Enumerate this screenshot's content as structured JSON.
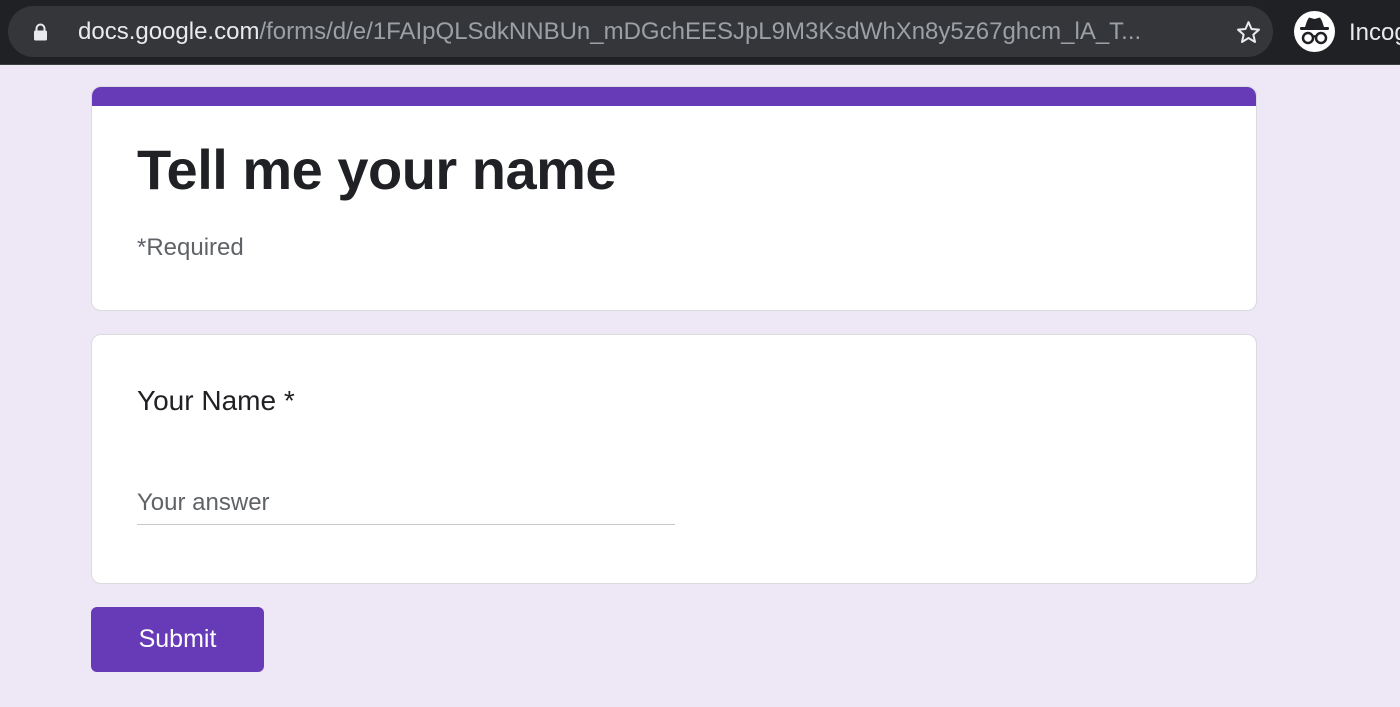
{
  "browser": {
    "url_host": "docs.google.com",
    "url_path": "/forms/d/e/1FAIpQLSdkNNBUn_mDGchEESJpL9M3KsdWhXn8y5z67ghcm_lA_T...",
    "profile_label": "Incog",
    "icons": [
      "lock-icon",
      "star-icon",
      "incognito-icon"
    ]
  },
  "form": {
    "title": "Tell me your name",
    "required_note": "*Required",
    "question": {
      "label": "Your Name *",
      "placeholder": "Your answer",
      "value": ""
    },
    "submit_label": "Submit"
  },
  "colors": {
    "accent": "#673ab7",
    "page_background": "#ede7f6"
  }
}
